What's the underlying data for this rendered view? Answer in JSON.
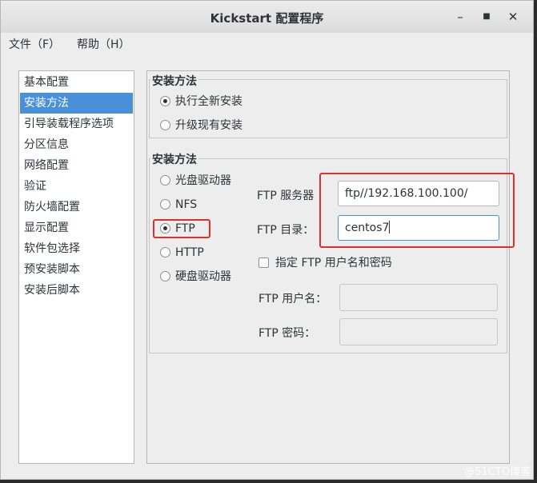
{
  "window": {
    "title": "Kickstart 配置程序",
    "controls": {
      "minimize": "–",
      "maximize": "■",
      "close": "✕"
    }
  },
  "menubar": {
    "file": "文件（F）",
    "help": "帮助（H）"
  },
  "sidebar": {
    "items": [
      {
        "label": "基本配置"
      },
      {
        "label": "安装方法",
        "selected": true
      },
      {
        "label": "引导装载程序选项"
      },
      {
        "label": "分区信息"
      },
      {
        "label": "网络配置"
      },
      {
        "label": "验证"
      },
      {
        "label": "防火墙配置"
      },
      {
        "label": "显示配置"
      },
      {
        "label": "软件包选择"
      },
      {
        "label": "预安装脚本"
      },
      {
        "label": "安装后脚本"
      }
    ]
  },
  "install_type": {
    "title": "安装方法",
    "options": [
      {
        "label": "执行全新安装",
        "selected": true
      },
      {
        "label": "升级现有安装",
        "selected": false
      }
    ]
  },
  "install_source": {
    "title": "安装方法",
    "options": [
      {
        "label": "光盘驱动器",
        "selected": false
      },
      {
        "label": "NFS",
        "selected": false
      },
      {
        "label": "FTP",
        "selected": true
      },
      {
        "label": "HTTP",
        "selected": false
      },
      {
        "label": "硬盘驱动器",
        "selected": false
      }
    ]
  },
  "ftp": {
    "server_label": "FTP 服务器",
    "server_value": "ftp//192.168.100.100/",
    "dir_label": "FTP 目录：",
    "dir_value": "centos7",
    "auth_checkbox_label": "指定  FTP 用户名和密码",
    "auth_checked": false,
    "user_label": "FTP 用户名：",
    "password_label": "FTP 密码："
  },
  "watermark": "@51CTO博客",
  "colors": {
    "highlight_red": "#e0302c",
    "selection_blue": "#4a90d9"
  }
}
